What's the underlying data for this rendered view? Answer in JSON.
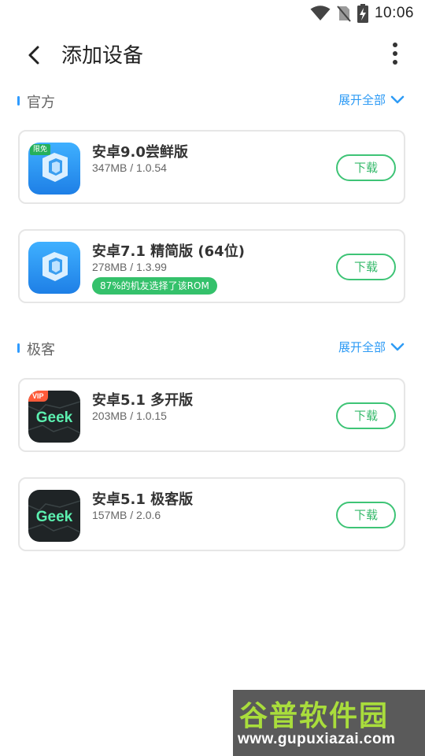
{
  "status_bar": {
    "time": "10:06",
    "icons": [
      "wifi-icon",
      "no-sim-icon",
      "battery-charging-icon"
    ]
  },
  "header": {
    "title": "添加设备",
    "back_icon": "chevron-left-icon",
    "menu_icon": "more-vertical-icon"
  },
  "colors": {
    "accent_blue": "#2e9bf5",
    "download_green": "#3ec476",
    "tag_green": "#34c16b",
    "vip_red": "#ff5b3a"
  },
  "sections": [
    {
      "label": "官方",
      "expand_label": "展开全部",
      "items": [
        {
          "name": "安卓9.0尝鲜版",
          "meta": "347MB / 1.0.54",
          "badge": "限免",
          "download_label": "下载",
          "icon": "vmos-cube-icon"
        },
        {
          "name": "安卓7.1 精简版 (64位)",
          "meta": "278MB / 1.3.99",
          "tag": "87%的机友选择了该ROM",
          "download_label": "下载",
          "icon": "vmos-cube-icon"
        }
      ]
    },
    {
      "label": "极客",
      "expand_label": "展开全部",
      "items": [
        {
          "name": "安卓5.1 多开版",
          "meta": "203MB / 1.0.15",
          "badge": "VIP",
          "download_label": "下载",
          "icon": "geek-logo-icon",
          "icon_text": "Geek"
        },
        {
          "name": "安卓5.1 极客版",
          "meta": "157MB / 2.0.6",
          "download_label": "下载",
          "icon": "geek-logo-icon",
          "icon_text": "Geek"
        }
      ]
    }
  ],
  "watermark": {
    "title": "谷普软件园",
    "url": "www.gupuxiazai.com"
  }
}
